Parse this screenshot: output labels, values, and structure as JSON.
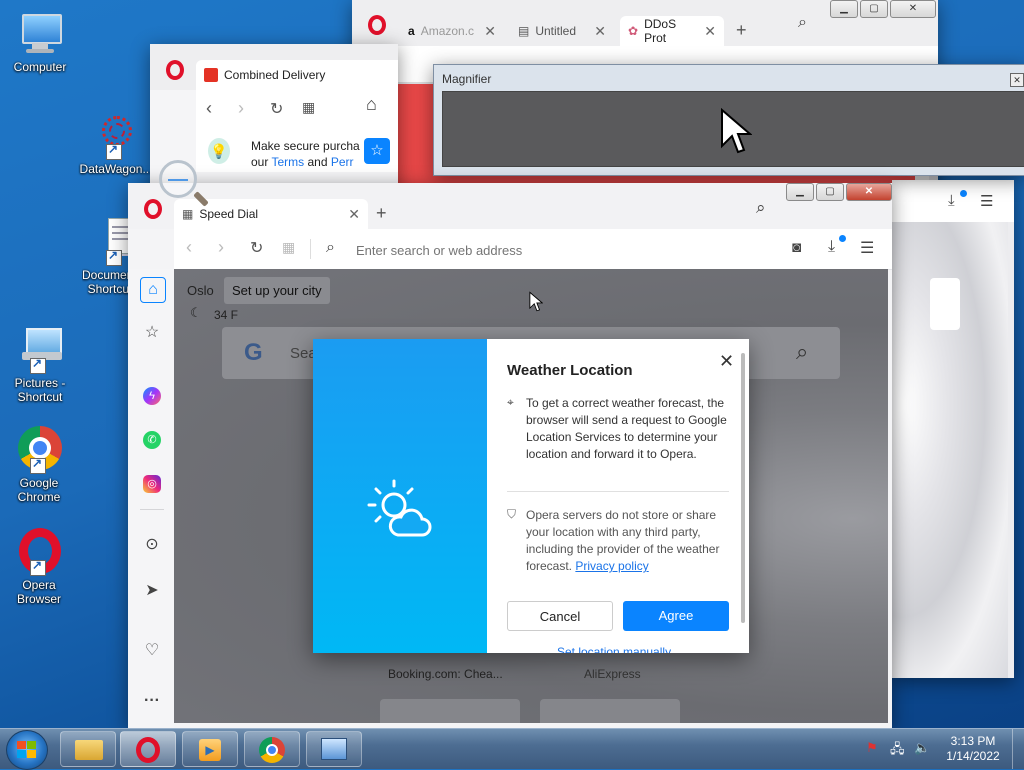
{
  "desktop": {
    "icons": [
      {
        "label": "Computer"
      },
      {
        "label": "DataWagon..."
      },
      {
        "label": "Documents Shortcut"
      },
      {
        "label": "Pictures - Shortcut"
      },
      {
        "label": "Google Chrome"
      },
      {
        "label": "Opera Browser"
      }
    ]
  },
  "back_window": {
    "tabs": [
      {
        "label": "Amazon.c"
      },
      {
        "label": "Untitled"
      },
      {
        "label": "DDoS Prot"
      }
    ]
  },
  "mid_window": {
    "tab_label": "Combined Delivery",
    "banner_line1": "Make secure purcha",
    "banner_line2_prefix": "our",
    "banner_terms": "Terms",
    "banner_and": "and",
    "banner_perr": "Perr"
  },
  "magnifier": {
    "title": "Magnifier"
  },
  "front_window": {
    "tab_label": "Speed Dial",
    "address_placeholder": "Enter search or web address",
    "weather": {
      "city": "Oslo",
      "setup_city": "Set up your city",
      "temp": "34 F"
    },
    "search_prefix": "Sea",
    "speed_dials": [
      {
        "label": "Booking.com: Chea..."
      },
      {
        "label": "AliExpress"
      }
    ]
  },
  "dialog": {
    "title": "Weather Location",
    "info_text": "To get a correct weather forecast, the browser will send a request to Google Location Services to determine your location and forward it to Opera.",
    "privacy_text": "Opera servers do not store or share your location with any third party, including the provider of the weather forecast.",
    "privacy_link": "Privacy policy",
    "cancel_label": "Cancel",
    "agree_label": "Agree",
    "set_manually": "Set location manually"
  },
  "taskbar": {
    "time": "3:13 PM",
    "date": "1/14/2022"
  },
  "colors": {
    "opera_red": "#e0102a",
    "accent_blue": "#0a84ff",
    "dialog_gradient_top": "#1b9cf2"
  }
}
